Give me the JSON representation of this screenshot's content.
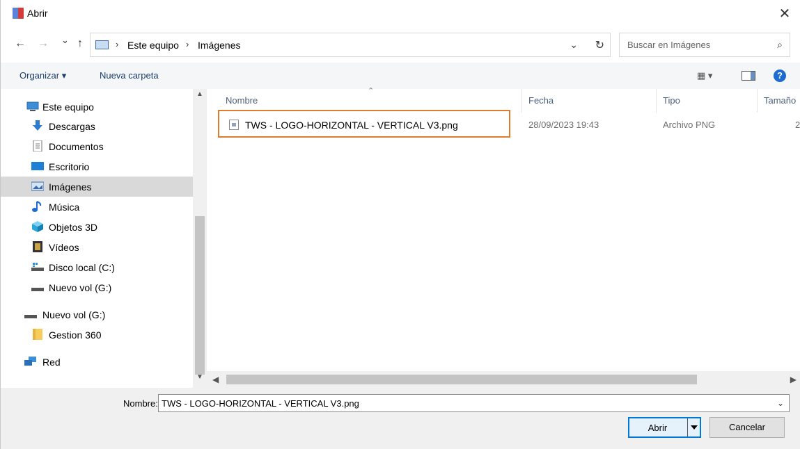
{
  "window": {
    "title": "Abrir",
    "close_glyph": "✕"
  },
  "nav": {
    "back_glyph": "←",
    "forward_glyph": "→",
    "recent_glyph": "⌄",
    "up_glyph": "↑",
    "breadcrumb": [
      "Este equipo",
      "Imágenes"
    ],
    "separator": "›",
    "dropdown_glyph": "⌄",
    "refresh_glyph": "↻"
  },
  "search": {
    "placeholder": "Buscar en Imágenes",
    "icon": "⌕"
  },
  "toolbar": {
    "organize": "Organizar ▾",
    "new_folder": "Nueva carpeta",
    "views": "▦ ▾",
    "help": "?"
  },
  "sidebar": {
    "items": [
      {
        "label": "Este equipo",
        "icon": "computer-icon"
      },
      {
        "label": "Descargas",
        "icon": "download-icon"
      },
      {
        "label": "Documentos",
        "icon": "document-icon"
      },
      {
        "label": "Escritorio",
        "icon": "desktop-icon"
      },
      {
        "label": "Imágenes",
        "icon": "pictures-icon",
        "selected": true
      },
      {
        "label": "Música",
        "icon": "music-icon"
      },
      {
        "label": "Objetos 3D",
        "icon": "cube-icon"
      },
      {
        "label": "Vídeos",
        "icon": "video-icon"
      },
      {
        "label": "Disco local (C:)",
        "icon": "drive-icon"
      },
      {
        "label": "Nuevo vol (G:)",
        "icon": "drive-icon"
      },
      {
        "label": "Nuevo vol (G:)",
        "icon": "drive-icon"
      },
      {
        "label": "Gestion 360",
        "icon": "folder-icon"
      },
      {
        "label": "Red",
        "icon": "network-icon"
      }
    ]
  },
  "columns": {
    "name": "Nombre",
    "date": "Fecha",
    "type": "Tipo",
    "size": "Tamaño"
  },
  "files": [
    {
      "name": "TWS - LOGO-HORIZONTAL - VERTICAL V3.png",
      "date": "28/09/2023 19:43",
      "type": "Archivo PNG",
      "size": "2"
    }
  ],
  "footer": {
    "name_label": "Nombre:",
    "name_value": "TWS - LOGO-HORIZONTAL - VERTICAL V3.png",
    "open": "Abrir",
    "cancel": "Cancelar"
  },
  "colors": {
    "accent": "#0078d7",
    "highlight": "#e07a2f",
    "selected": "#d9d9d9"
  }
}
